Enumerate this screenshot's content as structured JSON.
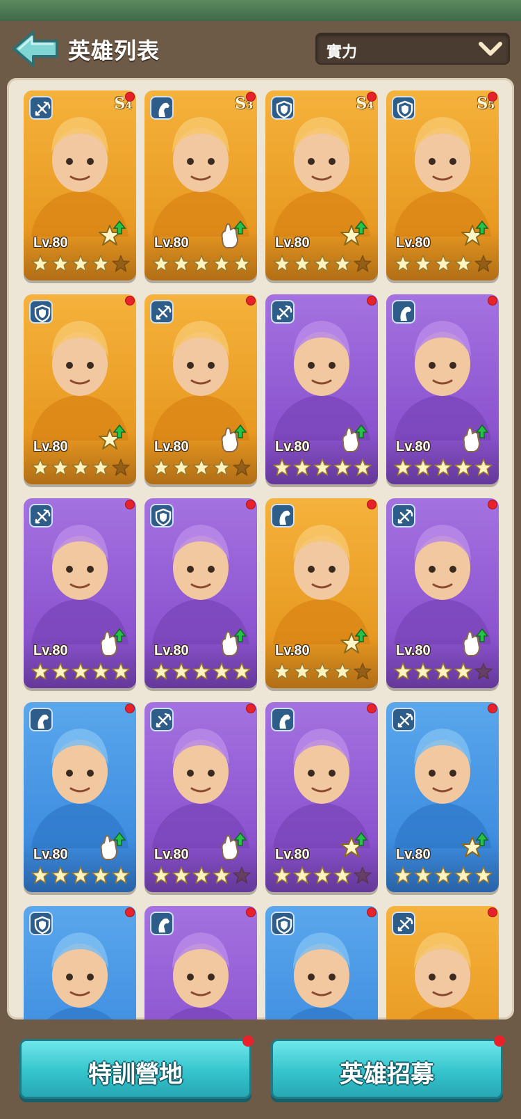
{
  "header": {
    "title": "英雄列表",
    "sort": {
      "selected": "實力"
    }
  },
  "colors": {
    "orange_card": "#e89a22",
    "purple_card": "#8c54cf",
    "blue_card": "#3f8ee0",
    "accent_button": "#35c4cc",
    "notification": "#e8222a"
  },
  "heroes": [
    {
      "color": "orange",
      "class": "crossbow",
      "rank": "S",
      "rank_level": "4",
      "level": "Lv.80",
      "stars": 5,
      "star_fill": 4,
      "upgrade": "star",
      "portrait": "hero-bride-icon"
    },
    {
      "color": "orange",
      "class": "horse",
      "rank": "S",
      "rank_level": "3",
      "level": "Lv.80",
      "stars": 5,
      "star_fill": 5,
      "upgrade": "glove",
      "portrait": "hero-witch-icon"
    },
    {
      "color": "orange",
      "class": "shield",
      "rank": "S",
      "rank_level": "4",
      "level": "Lv.80",
      "stars": 5,
      "star_fill": 4,
      "upgrade": "star",
      "portrait": "hero-spartan-icon"
    },
    {
      "color": "orange",
      "class": "shield",
      "rank": "S",
      "rank_level": "5",
      "level": "Lv.80",
      "stars": 5,
      "star_fill": 4,
      "upgrade": "star",
      "portrait": "hero-monk-icon"
    },
    {
      "color": "orange",
      "class": "shield",
      "rank": "",
      "rank_level": "",
      "level": "Lv.80",
      "stars": 5,
      "star_fill": 4,
      "upgrade": "star",
      "portrait": "hero-cleopatra-icon"
    },
    {
      "color": "orange",
      "class": "crossbow",
      "rank": "",
      "rank_level": "",
      "level": "Lv.80",
      "stars": 5,
      "star_fill": 4,
      "upgrade": "glove",
      "portrait": "hero-pirate-icon"
    },
    {
      "color": "purple",
      "class": "crossbow",
      "rank": "",
      "rank_level": "",
      "level": "Lv.80",
      "stars": 5,
      "star_fill": 5,
      "upgrade": "glove",
      "portrait": "hero-archer-icon"
    },
    {
      "color": "purple",
      "class": "horse",
      "rank": "",
      "rank_level": "",
      "level": "Lv.80",
      "stars": 5,
      "star_fill": 5,
      "upgrade": "glove",
      "portrait": "hero-knight-girl-icon"
    },
    {
      "color": "purple",
      "class": "crossbow",
      "rank": "",
      "rank_level": "",
      "level": "Lv.80",
      "stars": 5,
      "star_fill": 5,
      "upgrade": "glove",
      "portrait": "hero-swordsman-icon"
    },
    {
      "color": "purple",
      "class": "shield",
      "rank": "",
      "rank_level": "",
      "level": "Lv.80",
      "stars": 5,
      "star_fill": 5,
      "upgrade": "glove",
      "portrait": "hero-warrior-icon"
    },
    {
      "color": "orange",
      "class": "horse",
      "rank": "",
      "rank_level": "",
      "level": "Lv.80",
      "stars": 5,
      "star_fill": 4,
      "upgrade": "star",
      "portrait": "hero-joan-icon"
    },
    {
      "color": "purple",
      "class": "crossbow",
      "rank": "",
      "rank_level": "",
      "level": "Lv.80",
      "stars": 5,
      "star_fill": 4,
      "upgrade": "glove",
      "portrait": "hero-hanbok-icon"
    },
    {
      "color": "blue",
      "class": "horse",
      "rank": "",
      "rank_level": "",
      "level": "Lv.80",
      "stars": 5,
      "star_fill": 5,
      "upgrade": "glove",
      "portrait": "hero-helmet-icon"
    },
    {
      "color": "purple",
      "class": "crossbow",
      "rank": "",
      "rank_level": "",
      "level": "Lv.80",
      "stars": 5,
      "star_fill": 4,
      "upgrade": "glove",
      "portrait": "hero-umbrella-icon"
    },
    {
      "color": "purple",
      "class": "horse",
      "rank": "",
      "rank_level": "",
      "level": "Lv.80",
      "stars": 5,
      "star_fill": 4,
      "upgrade": "star",
      "portrait": "hero-cowboy-icon"
    },
    {
      "color": "blue",
      "class": "crossbow",
      "rank": "",
      "rank_level": "",
      "level": "Lv.80",
      "stars": 5,
      "star_fill": 5,
      "upgrade": "star",
      "portrait": "hero-ranger-icon"
    },
    {
      "color": "blue",
      "class": "shield",
      "rank": "",
      "rank_level": "",
      "level": "",
      "stars": 0,
      "star_fill": 0,
      "upgrade": "",
      "portrait": "hero-goggles-icon"
    },
    {
      "color": "purple",
      "class": "horse",
      "rank": "",
      "rank_level": "",
      "level": "",
      "stars": 0,
      "star_fill": 0,
      "upgrade": "",
      "portrait": "hero-sheikh-icon"
    },
    {
      "color": "blue",
      "class": "shield",
      "rank": "",
      "rank_level": "",
      "level": "",
      "stars": 0,
      "star_fill": 0,
      "upgrade": "",
      "portrait": "hero-dwarf-icon"
    },
    {
      "color": "orange",
      "class": "crossbow",
      "rank": "",
      "rank_level": "",
      "level": "",
      "stars": 0,
      "star_fill": 0,
      "upgrade": "",
      "portrait": "hero-cap-boy-icon"
    }
  ],
  "footer": {
    "training_label": "特訓營地",
    "recruit_label": "英雄招募"
  }
}
